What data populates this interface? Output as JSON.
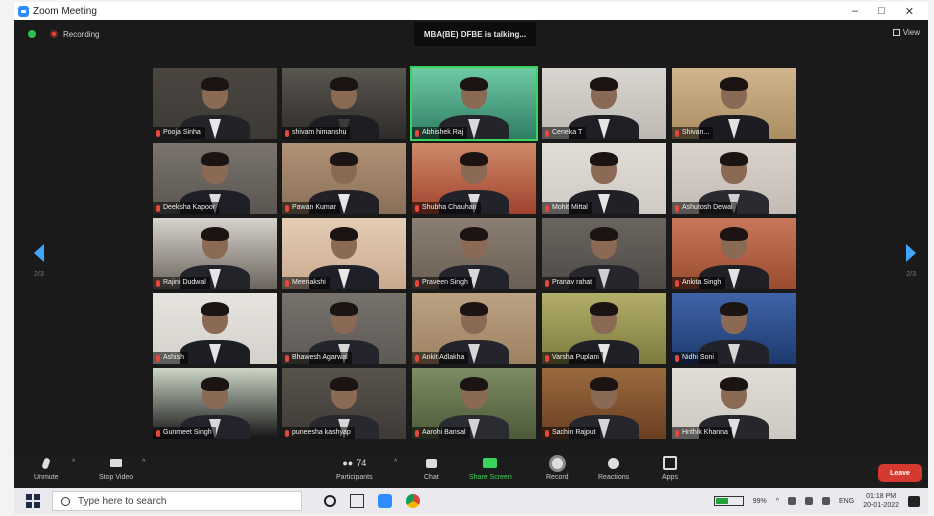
{
  "window": {
    "title": "Zoom Meeting",
    "controls": [
      "–",
      "□",
      "✕"
    ]
  },
  "topbar": {
    "recording_label": "Recording",
    "talking_banner": "MBA(BE) DFBE is talking...",
    "view_label": "View"
  },
  "pagination": {
    "left": "2/3",
    "right": "2/3"
  },
  "participants": [
    {
      "name": "Pooja Sinha",
      "bg": "#3d3a36",
      "wall": "#4a4540",
      "shirt": "#e8e8ea",
      "suit": "#222227"
    },
    {
      "name": "shivam himanshu",
      "bg": "#2e2c2a",
      "wall": "#5a5650",
      "shirt": "#3a3a3a",
      "suit": "#1e1e22"
    },
    {
      "name": "Abhishek Raj",
      "bg": "#2f7d63",
      "wall": "#6ecba5",
      "shirt": "#dadada",
      "suit": "#24252b"
    },
    {
      "name": "Ceneka T",
      "bg": "#bdb8b2",
      "wall": "#d9d5d0",
      "shirt": "#e6e6e6",
      "suit": "#1f1f25"
    },
    {
      "name": "Shivan...",
      "bg": "#ab8d62",
      "wall": "#d1b58c",
      "shirt": "#e3e3e3",
      "suit": "#1c1c22"
    },
    {
      "name": "Deeksha Kapoor",
      "bg": "#5a5550",
      "wall": "#7a746d",
      "shirt": "#dcdcdc",
      "suit": "#1f1f27"
    },
    {
      "name": "Pawan Kumar",
      "bg": "#8a6f58",
      "wall": "#b09276",
      "shirt": "#e6e6e6",
      "suit": "#202026"
    },
    {
      "name": "Shubha Chauhan",
      "bg": "#a0432e",
      "wall": "#cf8a6a",
      "shirt": "#dedede",
      "suit": "#22232a"
    },
    {
      "name": "Mohit Mittal",
      "bg": "#cfcac3",
      "wall": "#e0dcd6",
      "shirt": "#e6e6e6",
      "suit": "#202026"
    },
    {
      "name": "Ashutosh Dewal",
      "bg": "#c4bcb4",
      "wall": "#dad3cb",
      "shirt": "#d0d0d0",
      "suit": "#2a2a30"
    },
    {
      "name": "Rajini Dudwal",
      "bg": "#6c655e",
      "wall": "#d6d2cc",
      "shirt": "#e6e6e6",
      "suit": "#23232a"
    },
    {
      "name": "Meenakshi",
      "bg": "#c9a98e",
      "wall": "#e5cdb6",
      "shirt": "#e8e8e8",
      "suit": "#1f2027"
    },
    {
      "name": "Praveen Singh",
      "bg": "#6b5f55",
      "wall": "#8b7e72",
      "shirt": "#d8d8d8",
      "suit": "#22232b"
    },
    {
      "name": "Pranav rahat",
      "bg": "#4e4a46",
      "wall": "#6a655f",
      "shirt": "#cfcfcf",
      "suit": "#26262c"
    },
    {
      "name": "Ankita Singh",
      "bg": "#9a4c30",
      "wall": "#c8775a",
      "shirt": "#e2e2e2",
      "suit": "#1f1f26"
    },
    {
      "name": "Ashish",
      "bg": "#d4d0cb",
      "wall": "#e7e3de",
      "shirt": "#e4e4e4",
      "suit": "#1d1e24"
    },
    {
      "name": "Bhawesh Agarwal",
      "bg": "#5d5955",
      "wall": "#77726c",
      "shirt": "#d7d7d7",
      "suit": "#24252c"
    },
    {
      "name": "Ankit Adlakha",
      "bg": "#9d8262",
      "wall": "#bba283",
      "shirt": "#d6d6d6",
      "suit": "#24252c"
    },
    {
      "name": "Varsha Puplani",
      "bg": "#7d7a3e",
      "wall": "#b3ae6a",
      "shirt": "#e5e5e5",
      "suit": "#1f2026"
    },
    {
      "name": "Nidhi Soni",
      "bg": "#1d3a6e",
      "wall": "#3f64a8",
      "shirt": "#d6d6d6",
      "suit": "#22232a"
    },
    {
      "name": "Gunmeet Singh",
      "bg": "#151515",
      "wall": "#cdd6c6",
      "shirt": "#d8d8d8",
      "suit": "#23242b"
    },
    {
      "name": "puneesha kashyap",
      "bg": "#3f3a36",
      "wall": "#59534d",
      "shirt": "#d6d6d6",
      "suit": "#28292f"
    },
    {
      "name": "Aarohi Bansal",
      "bg": "#4c5a3a",
      "wall": "#7d8c63",
      "shirt": "#d3d3d3",
      "suit": "#2b2c31"
    },
    {
      "name": "Sachin Rajput",
      "bg": "#6a3f22",
      "wall": "#9a6a3e",
      "shirt": "#d6d6d6",
      "suit": "#25262c"
    },
    {
      "name": "Hrithik Khanna",
      "bg": "#cdc8c2",
      "wall": "#e0dcd6",
      "shirt": "#e0e0e0",
      "suit": "#26272d"
    }
  ],
  "controls": {
    "unmute": "Unmute",
    "stop_video": "Stop Video",
    "participants": "Participants",
    "participants_count": "74",
    "chat": "Chat",
    "share_screen": "Share Screen",
    "record": "Record",
    "reactions": "Reactions",
    "apps": "Apps",
    "leave": "Leave"
  },
  "taskbar": {
    "search_placeholder": "Type here to search",
    "battery_label": "99%",
    "language": "ENG",
    "time": "01:18 PM",
    "date": "20-01-2022"
  }
}
